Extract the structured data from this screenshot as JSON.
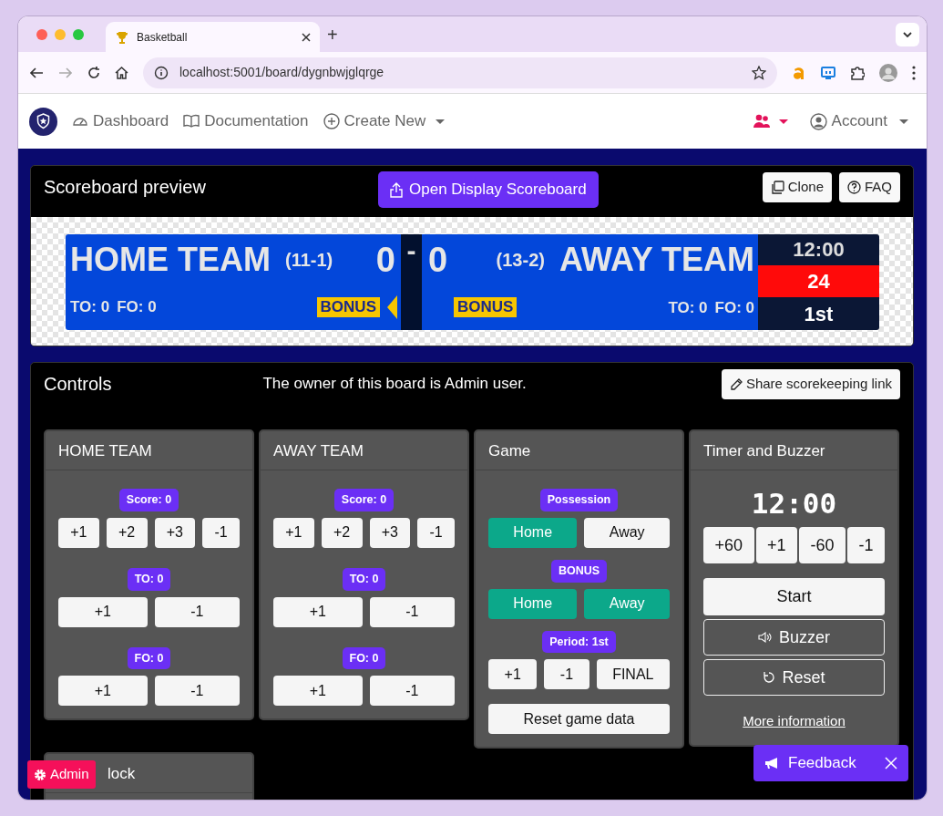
{
  "browser": {
    "tab_title": "Basketball",
    "new_tab": "+",
    "url": "localhost:5001/board/dygnbwjglqrge"
  },
  "navbar": {
    "items": [
      {
        "kind": "dashboard",
        "label": "Dashboard",
        "dropdown": false
      },
      {
        "kind": "docs",
        "label": "Documentation",
        "dropdown": false
      },
      {
        "kind": "create",
        "label": "Create New",
        "dropdown": true
      }
    ],
    "account": "Account"
  },
  "preview": {
    "title": "Scoreboard preview",
    "open_button": "Open Display Scoreboard",
    "buttons": [
      {
        "kind": "clone",
        "label": "Clone"
      },
      {
        "kind": "faq",
        "label": "FAQ"
      }
    ],
    "scoreboard": {
      "teams": [
        {
          "name": "HOME TEAM",
          "record": "(11-1)",
          "score": "0",
          "to": "TO: 0",
          "fo": "FO: 0",
          "bonus": "BONUS",
          "possession": true
        },
        {
          "name": "AWAY TEAM",
          "record": "(13-2)",
          "score": "0",
          "to": "TO: 0",
          "fo": "FO: 0",
          "bonus": "BONUS",
          "possession": false
        }
      ],
      "separator": "-",
      "clock": "12:00",
      "shot_clock": "24",
      "period": "1st"
    }
  },
  "controls": {
    "title": "Controls",
    "owner_note": "The owner of this board is Admin user.",
    "share_button": "Share scorekeeping link",
    "panels": [
      {
        "kind": "team",
        "title": "HOME TEAM",
        "groups": [
          {
            "kind": "buttons",
            "label": "Score: 0",
            "buttons": [
              "+1",
              "+2",
              "+3",
              "-1"
            ]
          },
          {
            "kind": "buttons",
            "label": "TO: 0",
            "buttons": [
              "+1",
              "-1"
            ]
          },
          {
            "kind": "buttons",
            "label": "FO: 0",
            "buttons": [
              "+1",
              "-1"
            ]
          }
        ]
      },
      {
        "kind": "team",
        "title": "AWAY TEAM",
        "groups": [
          {
            "kind": "buttons",
            "label": "Score: 0",
            "buttons": [
              "+1",
              "+2",
              "+3",
              "-1"
            ]
          },
          {
            "kind": "buttons",
            "label": "TO: 0",
            "buttons": [
              "+1",
              "-1"
            ]
          },
          {
            "kind": "buttons",
            "label": "FO: 0",
            "buttons": [
              "+1",
              "-1"
            ]
          }
        ]
      },
      {
        "kind": "game",
        "title": "Game",
        "groups": [
          {
            "kind": "toggle",
            "label": "Possession",
            "options": [
              {
                "label": "Home",
                "selected": true
              },
              {
                "label": "Away",
                "selected": false
              }
            ]
          },
          {
            "kind": "toggle",
            "label": "BONUS",
            "options": [
              {
                "label": "Home",
                "selected": true
              },
              {
                "label": "Away",
                "selected": true
              }
            ]
          },
          {
            "kind": "buttons",
            "label": "Period: 1st",
            "buttons": [
              "+1",
              "-1",
              "FINAL"
            ]
          }
        ],
        "reset_button": "Reset game data"
      },
      {
        "kind": "timer",
        "title": "Timer and Buzzer",
        "time": "12:00",
        "adjust": [
          "+60",
          "+1",
          "-60",
          "-1"
        ],
        "start": "Start",
        "buzzer": "Buzzer",
        "reset": "Reset",
        "link": "More information"
      },
      {
        "kind": "clock",
        "title": "lock"
      }
    ]
  },
  "admin_button": "Admin",
  "feedback": {
    "label": "Feedback"
  }
}
